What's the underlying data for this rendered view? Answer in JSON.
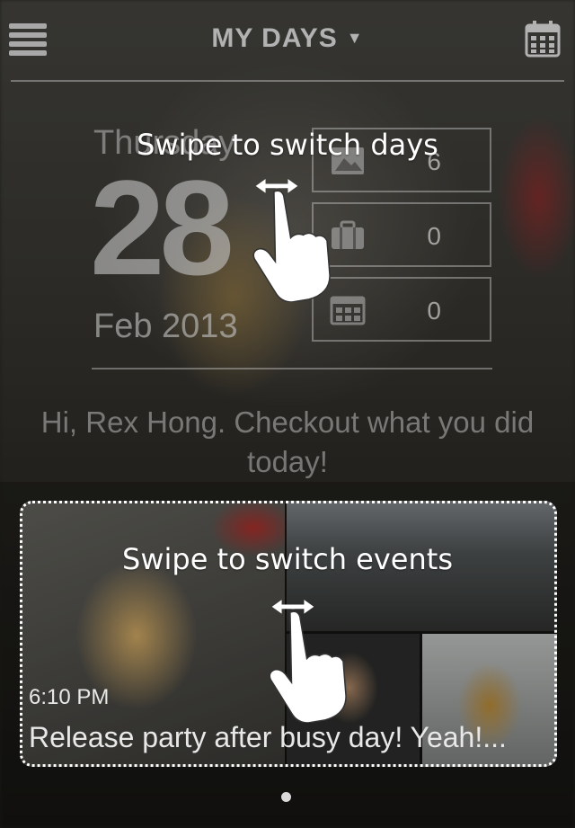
{
  "header": {
    "menu_icon": "hamburger-menu-icon",
    "title": "MY DAYS",
    "title_caret": "▼",
    "calendar_icon": "calendar-icon"
  },
  "date": {
    "weekday": "Thursday",
    "day": "28",
    "month_year": "Feb  2013"
  },
  "stats": [
    {
      "icon": "photo-icon",
      "value": "6"
    },
    {
      "icon": "briefcase-icon",
      "value": "0"
    },
    {
      "icon": "calendar-grid-icon",
      "value": "0"
    }
  ],
  "greeting": "Hi, Rex Hong. Checkout what you did today!",
  "event": {
    "time": "6:10 PM",
    "caption": "Release party after busy day! Yeah!..."
  },
  "tutorial": {
    "swipe_days": "Swipe to switch days",
    "swipe_events": "Swipe to switch events"
  },
  "colors": {
    "overlay_text": "#ffffff",
    "muted_text": "#c9c9c9"
  }
}
